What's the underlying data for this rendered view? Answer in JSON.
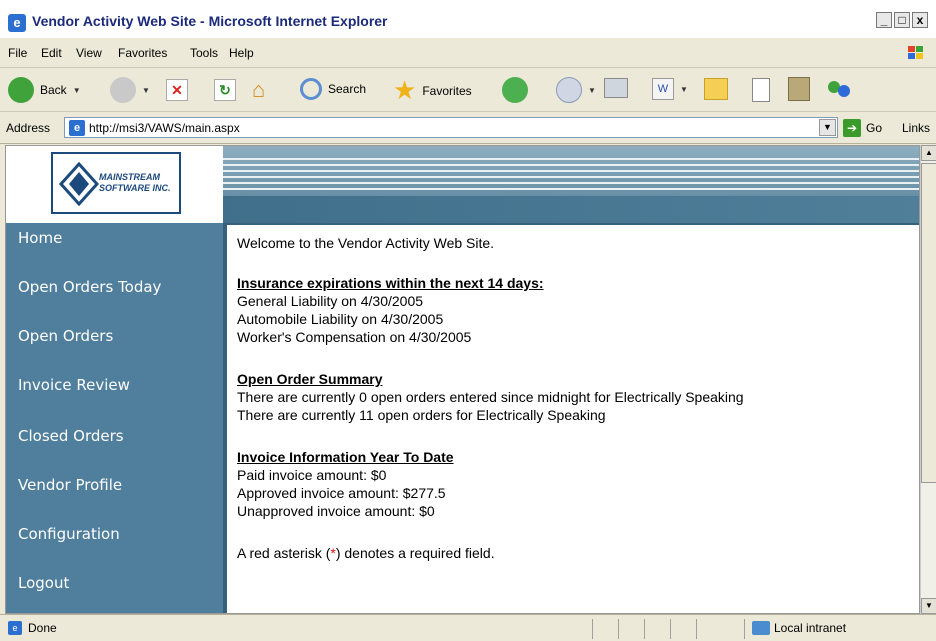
{
  "window": {
    "title": "Vendor Activity Web Site - Microsoft Internet Explorer",
    "controls": [
      "_",
      "□",
      "x"
    ]
  },
  "menu": [
    "File",
    "Edit",
    "View",
    "Favorites",
    "Tools",
    "Help"
  ],
  "toolbar": {
    "back": "Back",
    "search": "Search",
    "favorites": "Favorites"
  },
  "address": {
    "label": "Address",
    "url": "http://msi3/VAWS/main.aspx",
    "go": "Go",
    "links": "Links"
  },
  "logo": {
    "text_line1": "MAINSTREAM",
    "text_line2": "SOFTWARE INC."
  },
  "nav": [
    "Home",
    "Open Orders Today",
    "Open Orders",
    "Invoice Review",
    "Closed Orders",
    "Vendor Profile",
    "Configuration",
    "Logout"
  ],
  "main": {
    "welcome": "Welcome to the Vendor Activity Web Site.",
    "insurance_header": "Insurance expirations within the next 14 days:",
    "insurance_items": [
      "General Liability on 4/30/2005",
      "Automobile Liability on 4/30/2005",
      "Worker's Compensation on 4/30/2005"
    ],
    "order_header": "Open Order Summary",
    "order_items": [
      "There are currently 0 open orders entered since midnight for Electrically Speaking",
      "There are currently 11 open orders for Electrically Speaking"
    ],
    "invoice_header": "Invoice Information Year To Date",
    "invoice_items": [
      "Paid invoice amount: $0",
      "Approved invoice amount: $277.5",
      "Unapproved invoice amount: $0"
    ],
    "asterisk_note_prefix": "A red asterisk (",
    "asterisk": "*",
    "asterisk_note_suffix": ") denotes a required field."
  },
  "status": {
    "text": "Done",
    "zone": "Local intranet"
  },
  "colors": {
    "nav_bg": "#4f7f9c",
    "title_text": "#1b2a7a",
    "asterisk": "#dd1111"
  }
}
